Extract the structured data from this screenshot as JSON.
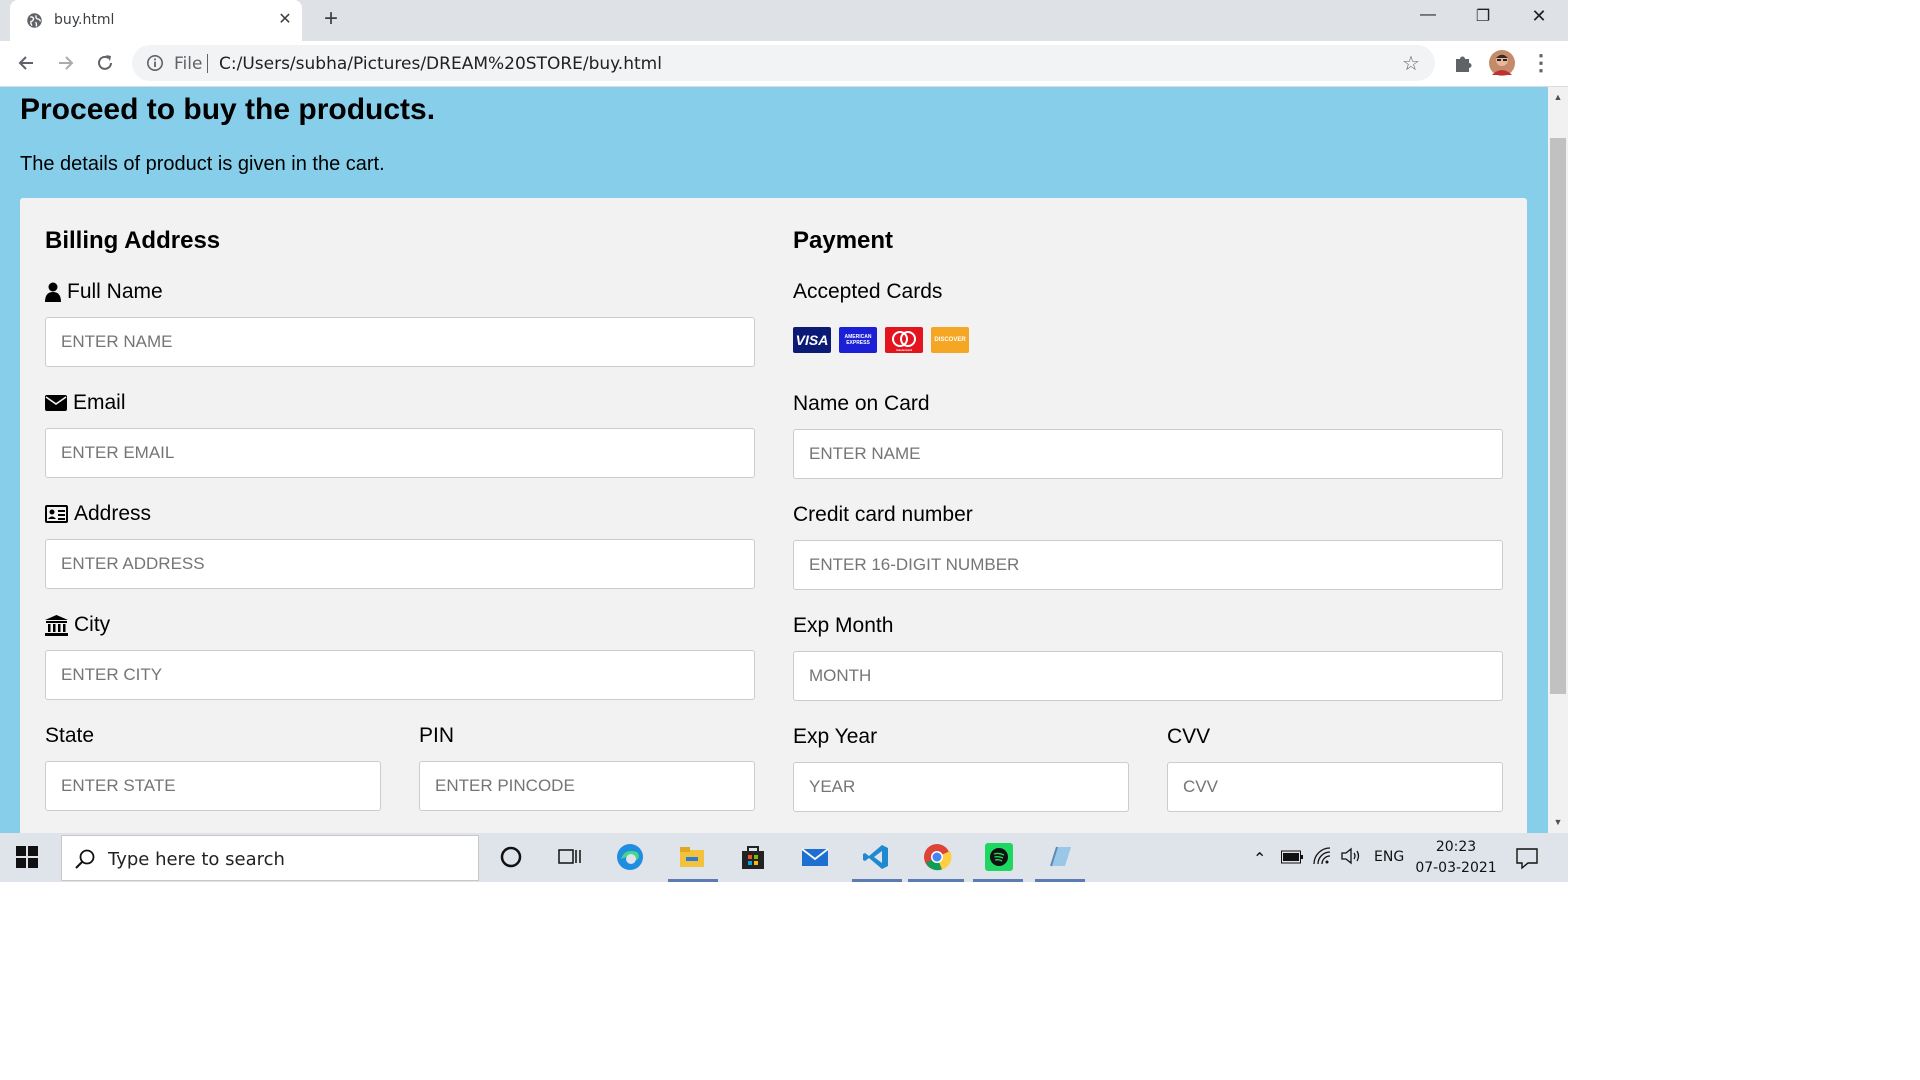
{
  "browser": {
    "tab_title": "buy.html",
    "tab_close": "✕",
    "new_tab": "+",
    "address_scheme_label": "File",
    "address_url": "C:/Users/subha/Pictures/DREAM%20STORE/buy.html",
    "window_minimize": "—",
    "window_restore": "❐",
    "window_close": "✕"
  },
  "page": {
    "title": "Proceed to buy the products.",
    "subtitle": "The details of product is given in the cart.",
    "background_color": "#87ceeb"
  },
  "billing": {
    "heading": "Billing Address",
    "full_name": {
      "label": "Full Name",
      "placeholder": "ENTER NAME",
      "icon": "user-icon"
    },
    "email": {
      "label": "Email",
      "placeholder": "ENTER EMAIL",
      "icon": "envelope-icon"
    },
    "address": {
      "label": "Address",
      "placeholder": "ENTER ADDRESS",
      "icon": "address-card-icon"
    },
    "city": {
      "label": "City",
      "placeholder": "ENTER CITY",
      "icon": "institution-icon"
    },
    "state": {
      "label": "State",
      "placeholder": "ENTER STATE"
    },
    "pin": {
      "label": "PIN",
      "placeholder": "ENTER PINCODE"
    }
  },
  "payment": {
    "heading": "Payment",
    "accepted_cards_label": "Accepted Cards",
    "cards": [
      {
        "name": "visa-icon",
        "text": "VISA"
      },
      {
        "name": "amex-icon",
        "text": "AMERICAN EXPRESS"
      },
      {
        "name": "mastercard-icon",
        "text": "mastercard"
      },
      {
        "name": "discover-icon",
        "text": "DISCOVER"
      }
    ],
    "name_on_card": {
      "label": "Name on Card",
      "placeholder": "ENTER NAME"
    },
    "card_number": {
      "label": "Credit card number",
      "placeholder": "ENTER 16-DIGIT NUMBER"
    },
    "exp_month": {
      "label": "Exp Month",
      "placeholder": "MONTH"
    },
    "exp_year": {
      "label": "Exp Year",
      "placeholder": "YEAR"
    },
    "cvv": {
      "label": "CVV",
      "placeholder": "CVV"
    }
  },
  "taskbar": {
    "search_placeholder": "Type here to search",
    "language": "ENG",
    "time": "20:23",
    "date": "07-03-2021"
  }
}
